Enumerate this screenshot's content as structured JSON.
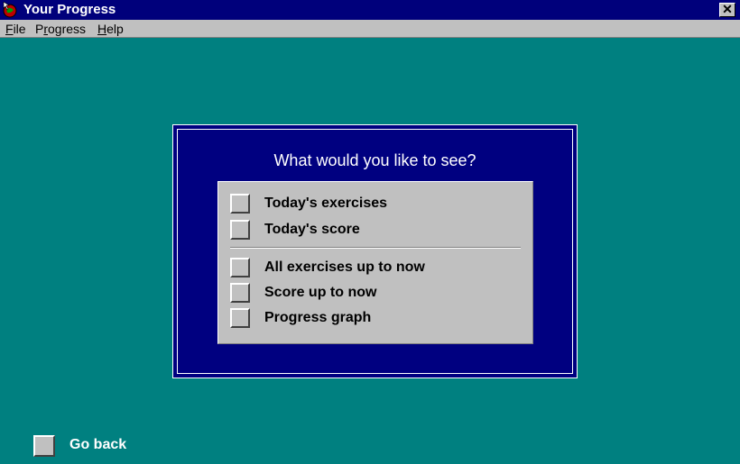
{
  "window": {
    "title": "Your Progress",
    "close_glyph": "✕",
    "app_icon": "globe-cursor-icon"
  },
  "menu": {
    "file": {
      "accel": "F",
      "rest": "ile"
    },
    "progress": {
      "pre": "P",
      "accel": "r",
      "rest": "ogress"
    },
    "help": {
      "accel": "H",
      "rest": "elp"
    }
  },
  "panel": {
    "question": "What would you like to see?",
    "group_today": [
      {
        "label": "Today's exercises"
      },
      {
        "label": "Today's score"
      }
    ],
    "group_all": [
      {
        "label": "All exercises up to now"
      },
      {
        "label": "Score up to now"
      },
      {
        "label": "Progress graph"
      }
    ]
  },
  "footer": {
    "go_back_label": "Go back"
  },
  "colors": {
    "desktop": "#008080",
    "titlebar": "#00007b",
    "panel": "#000080",
    "face": "#c0c0c0"
  }
}
